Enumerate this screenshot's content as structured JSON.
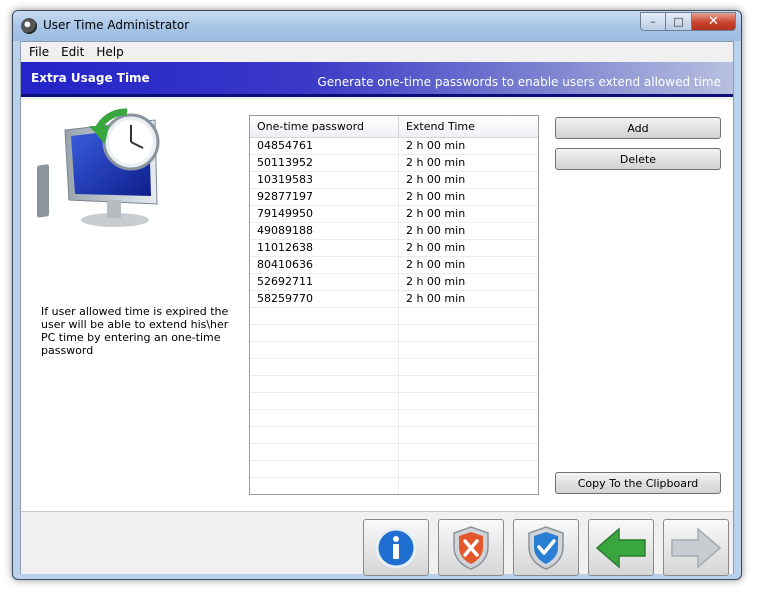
{
  "window": {
    "title": "User Time Administrator",
    "controls": {
      "minimize": "–",
      "maximize": "□",
      "close": "✕"
    }
  },
  "menu": [
    "File",
    "Edit",
    "Help"
  ],
  "banner": {
    "title": "Extra Usage Time",
    "subtitle": "Generate one-time passwords to enable users extend allowed time"
  },
  "description": "If user allowed time is expired the user will be able to extend his\\her PC time by entering an one-time password",
  "table": {
    "columns": [
      "One-time password",
      "Extend Time"
    ],
    "rows": [
      [
        "04854761",
        "2 h 00 min"
      ],
      [
        "50113952",
        "2 h 00 min"
      ],
      [
        "10319583",
        "2 h 00 min"
      ],
      [
        "92877197",
        "2 h 00 min"
      ],
      [
        "79149950",
        "2 h 00 min"
      ],
      [
        "49089188",
        "2 h 00 min"
      ],
      [
        "11012638",
        "2 h 00 min"
      ],
      [
        "80410636",
        "2 h 00 min"
      ],
      [
        "52692711",
        "2 h 00 min"
      ],
      [
        "58259770",
        "2 h 00 min"
      ]
    ]
  },
  "buttons": {
    "add": "Add",
    "delete": "Delete",
    "copy": "Copy To the Clipboard"
  },
  "footer_buttons": [
    "info-icon",
    "cancel-shield-icon",
    "ok-shield-icon",
    "back-arrow-icon",
    "next-arrow-icon"
  ],
  "colors": {
    "banner_start": "#2323c9",
    "banner_end": "#b8c0e0",
    "accent_green": "#3aa640",
    "info_blue": "#1f6fd1",
    "cancel_orange": "#e2572b",
    "ok_blue": "#2a7fd4"
  }
}
